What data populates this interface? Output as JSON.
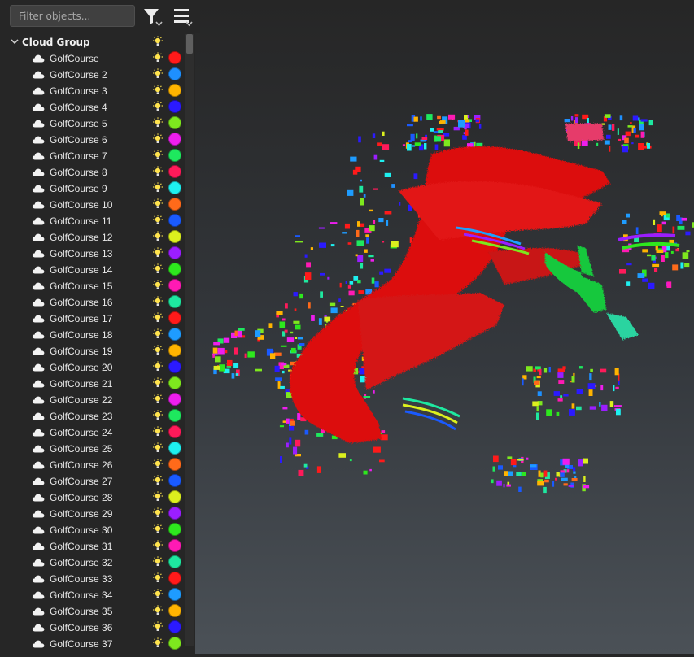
{
  "toolbar": {
    "filter_placeholder": "Filter objects...",
    "filter_value": "",
    "filter_button_icon": "filter-icon",
    "menu_button_icon": "menu-icon"
  },
  "tree": {
    "group_label": "Cloud Group",
    "visibility_icon": "lightbulb-icon",
    "item_icon": "cloud-icon",
    "items": [
      {
        "label": "GolfCourse",
        "color": "#ff1a1a"
      },
      {
        "label": "GolfCourse 2",
        "color": "#1e90ff"
      },
      {
        "label": "GolfCourse 3",
        "color": "#ffb400"
      },
      {
        "label": "GolfCourse 4",
        "color": "#2b1aff"
      },
      {
        "label": "GolfCourse 5",
        "color": "#7ee81e"
      },
      {
        "label": "GolfCourse 6",
        "color": "#ee1eee"
      },
      {
        "label": "GolfCourse 7",
        "color": "#1ee85e"
      },
      {
        "label": "GolfCourse 8",
        "color": "#ff1a5a"
      },
      {
        "label": "GolfCourse 9",
        "color": "#1ef0f0"
      },
      {
        "label": "GolfCourse 10",
        "color": "#ff6a1a"
      },
      {
        "label": "GolfCourse 11",
        "color": "#1a5aff"
      },
      {
        "label": "GolfCourse 12",
        "color": "#dcf01e"
      },
      {
        "label": "GolfCourse 13",
        "color": "#9b1eff"
      },
      {
        "label": "GolfCourse 14",
        "color": "#2ee81e"
      },
      {
        "label": "GolfCourse 15",
        "color": "#ff1ab4"
      },
      {
        "label": "GolfCourse 16",
        "color": "#1ee8a0"
      },
      {
        "label": "GolfCourse 17",
        "color": "#ff1a1a"
      },
      {
        "label": "GolfCourse 18",
        "color": "#1e9cff"
      },
      {
        "label": "GolfCourse 19",
        "color": "#ffb400"
      },
      {
        "label": "GolfCourse 20",
        "color": "#2b1aff"
      },
      {
        "label": "GolfCourse 21",
        "color": "#7ee81e"
      },
      {
        "label": "GolfCourse 22",
        "color": "#ee1eee"
      },
      {
        "label": "GolfCourse 23",
        "color": "#1ee85e"
      },
      {
        "label": "GolfCourse 24",
        "color": "#ff1a5a"
      },
      {
        "label": "GolfCourse 25",
        "color": "#1ef0f0"
      },
      {
        "label": "GolfCourse 26",
        "color": "#ff6a1a"
      },
      {
        "label": "GolfCourse 27",
        "color": "#1a5aff"
      },
      {
        "label": "GolfCourse 28",
        "color": "#dcf01e"
      },
      {
        "label": "GolfCourse 29",
        "color": "#9b1eff"
      },
      {
        "label": "GolfCourse 30",
        "color": "#2ee81e"
      },
      {
        "label": "GolfCourse 31",
        "color": "#ff1ab4"
      },
      {
        "label": "GolfCourse 32",
        "color": "#1ee8a0"
      },
      {
        "label": "GolfCourse 33",
        "color": "#ff1a1a"
      },
      {
        "label": "GolfCourse 34",
        "color": "#1e9cff"
      },
      {
        "label": "GolfCourse 35",
        "color": "#ffb400"
      },
      {
        "label": "GolfCourse 36",
        "color": "#2b1aff"
      },
      {
        "label": "GolfCourse 37",
        "color": "#7ee81e"
      }
    ]
  },
  "viewport": {
    "background_top": "#262626",
    "background_bottom": "#4b5157",
    "dominant_cloud_color": "#e01212"
  }
}
